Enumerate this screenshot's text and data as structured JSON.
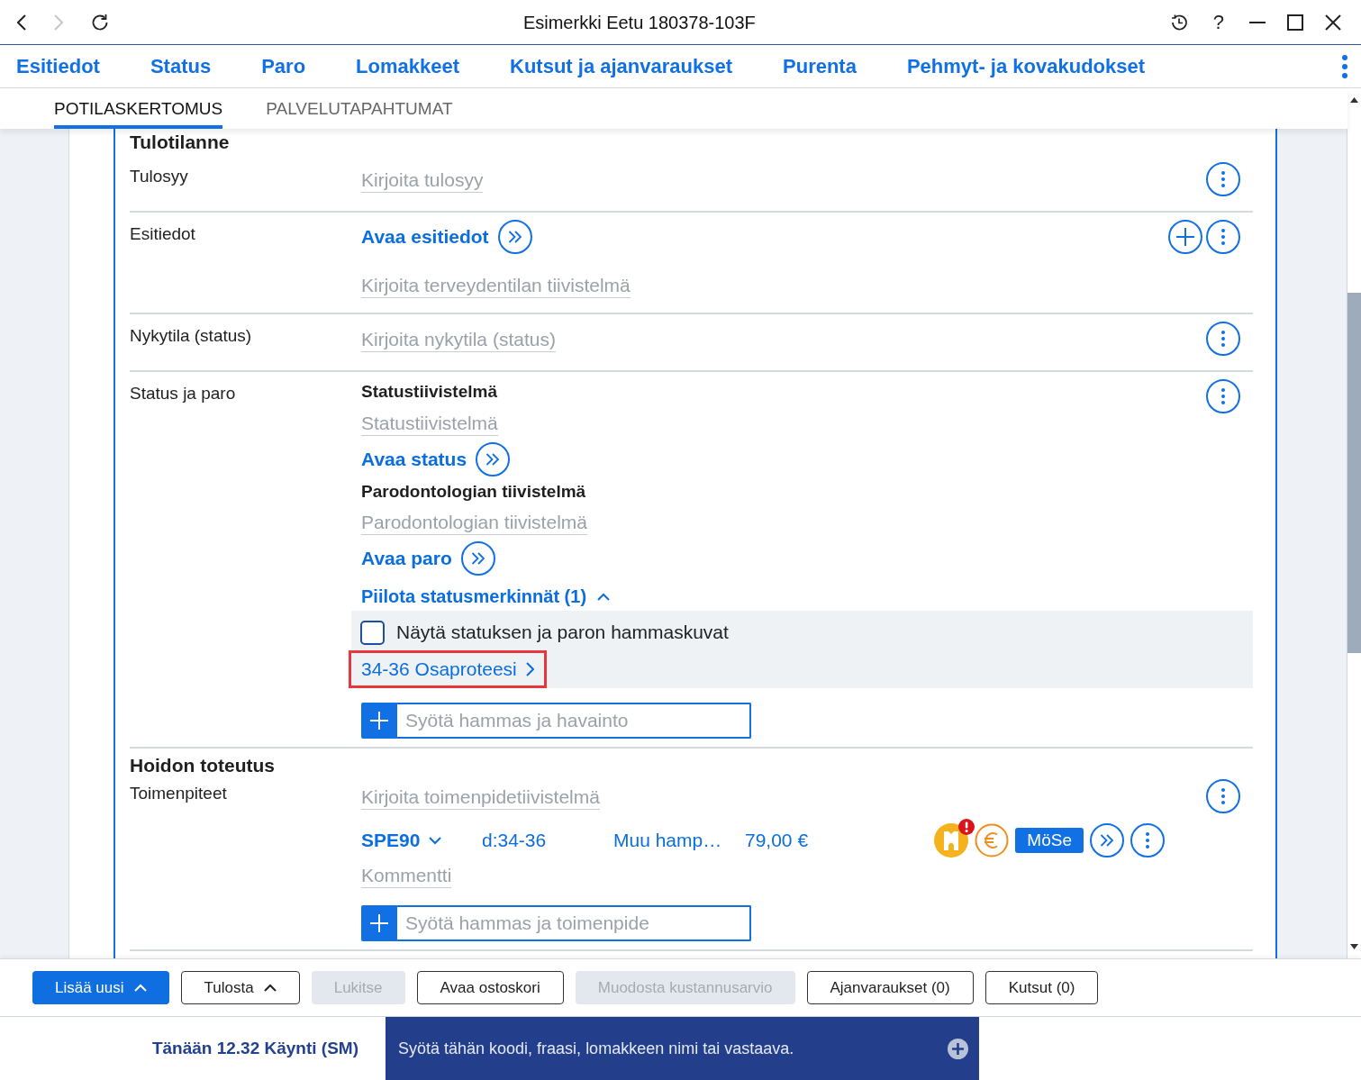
{
  "window": {
    "title": "Esimerkki Eetu 180378-103F",
    "back_disabled": false,
    "forward_disabled": true,
    "help_label": "?"
  },
  "main_nav": [
    "Esitiedot",
    "Status",
    "Paro",
    "Lomakkeet",
    "Kutsut ja ajanvaraukset",
    "Purenta",
    "Pehmyt- ja kovakudokset"
  ],
  "sub_tabs": [
    {
      "label": "POTILASKERTOMUS",
      "selected": true
    },
    {
      "label": "PALVELUTAPAHTUMAT",
      "selected": false
    }
  ],
  "sections": [
    {
      "heading": "Tulotilanne",
      "rows": [
        {
          "label": "Tulosyy",
          "actions": [
            {
              "kind": "more"
            }
          ],
          "items": [
            {
              "kind": "field",
              "placeholder": "Kirjoita tulosyy"
            }
          ]
        },
        {
          "label": "Esitiedot",
          "actions": [
            {
              "kind": "add"
            },
            {
              "kind": "more"
            }
          ],
          "items": [
            {
              "kind": "link",
              "label": "Avaa esitiedot"
            },
            {
              "kind": "field",
              "placeholder": "Kirjoita terveydentilan tiivistelmä"
            }
          ]
        },
        {
          "label": "Nykytila (status)",
          "actions": [
            {
              "kind": "more"
            }
          ],
          "items": [
            {
              "kind": "field",
              "placeholder": "Kirjoita nykytila (status)"
            }
          ]
        },
        {
          "label": "Status ja paro",
          "actions": [
            {
              "kind": "more"
            }
          ],
          "items": [
            {
              "kind": "subheading",
              "text": "Statustiivistelmä"
            },
            {
              "kind": "field",
              "placeholder": "Statustiivistelmä"
            },
            {
              "kind": "link",
              "label": "Avaa status"
            },
            {
              "kind": "subheading",
              "text": "Parodontologian tiivistelmä"
            },
            {
              "kind": "field",
              "placeholder": "Parodontologian tiivistelmä"
            },
            {
              "kind": "link",
              "label": "Avaa paro"
            },
            {
              "kind": "toggle",
              "label": "Piilota statusmerkinnät (1)",
              "expanded": true
            },
            {
              "kind": "panel",
              "checkbox": {
                "label": "Näytä statuksen ja paron hammaskuvat",
                "checked": false
              },
              "entries": [
                {
                  "label": "34-36 Osaproteesi",
                  "highlighted": true
                }
              ]
            },
            {
              "kind": "entry",
              "placeholder": "Syötä hammas ja havainto"
            }
          ]
        }
      ]
    },
    {
      "heading": "Hoidon toteutus",
      "rows": [
        {
          "label": "Toimenpiteet",
          "actions": [
            {
              "kind": "more"
            }
          ],
          "items": [
            {
              "kind": "field",
              "placeholder": "Kirjoita toimenpidetiivistelmä"
            },
            {
              "kind": "procedure",
              "code": "SPE90",
              "teeth": "d:34-36",
              "description": "Muu hamp…",
              "price": "79,00 €",
              "alert": true,
              "badge": "MöSe"
            },
            {
              "kind": "field",
              "placeholder": "Kommentti"
            },
            {
              "kind": "entry",
              "placeholder": "Syötä hammas ja toimenpide"
            }
          ]
        }
      ]
    }
  ],
  "toolbar": [
    {
      "label": "Lisää uusi",
      "kind": "primary",
      "disabled": false,
      "caret": true
    },
    {
      "label": "Tulosta",
      "kind": "secondary",
      "disabled": false,
      "caret": true
    },
    {
      "label": "Lukitse",
      "kind": "secondary",
      "disabled": true,
      "caret": false
    },
    {
      "label": "Avaa ostoskori",
      "kind": "secondary",
      "disabled": false,
      "caret": false
    },
    {
      "label": "Muodosta kustannusarvio",
      "kind": "secondary",
      "disabled": true,
      "caret": false
    },
    {
      "label": "Ajanvaraukset (0)",
      "kind": "secondary",
      "disabled": false,
      "caret": false
    },
    {
      "label": "Kutsut (0)",
      "kind": "secondary",
      "disabled": false,
      "caret": false
    }
  ],
  "status_bar": {
    "visit": "Tänään 12.32 Käynti (SM)",
    "command": {
      "placeholder": "Syötä tähän koodi, fraasi, lomakkeen nimi tai vastaava."
    }
  }
}
